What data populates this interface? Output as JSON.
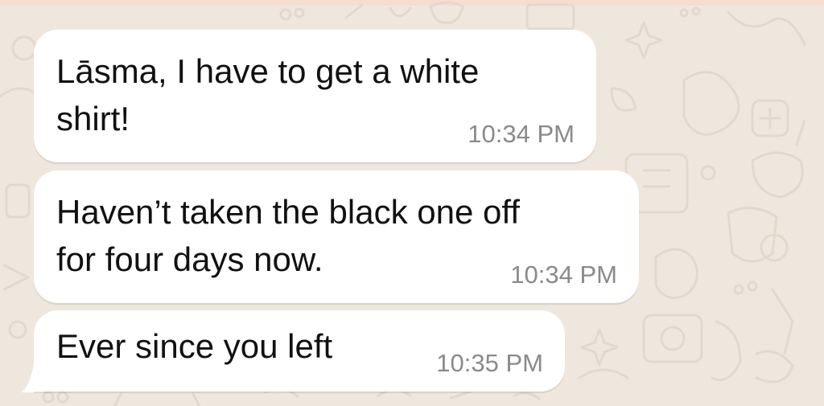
{
  "messages": [
    {
      "line1": "Lāsma, I have to get a white",
      "line2": "shirt!",
      "time": "10:34 PM"
    },
    {
      "line1": "Haven’t taken the black one off",
      "line2": "for four days now.",
      "time": "10:34 PM"
    },
    {
      "line1": "Ever since you left",
      "time": "10:35 PM"
    }
  ],
  "colors": {
    "wallpaper": "#efe7de",
    "bubble": "#ffffff",
    "text": "#111111",
    "timestamp": "#8a8a8a"
  },
  "icons": [
    "wallpaper-doodle-pattern"
  ]
}
